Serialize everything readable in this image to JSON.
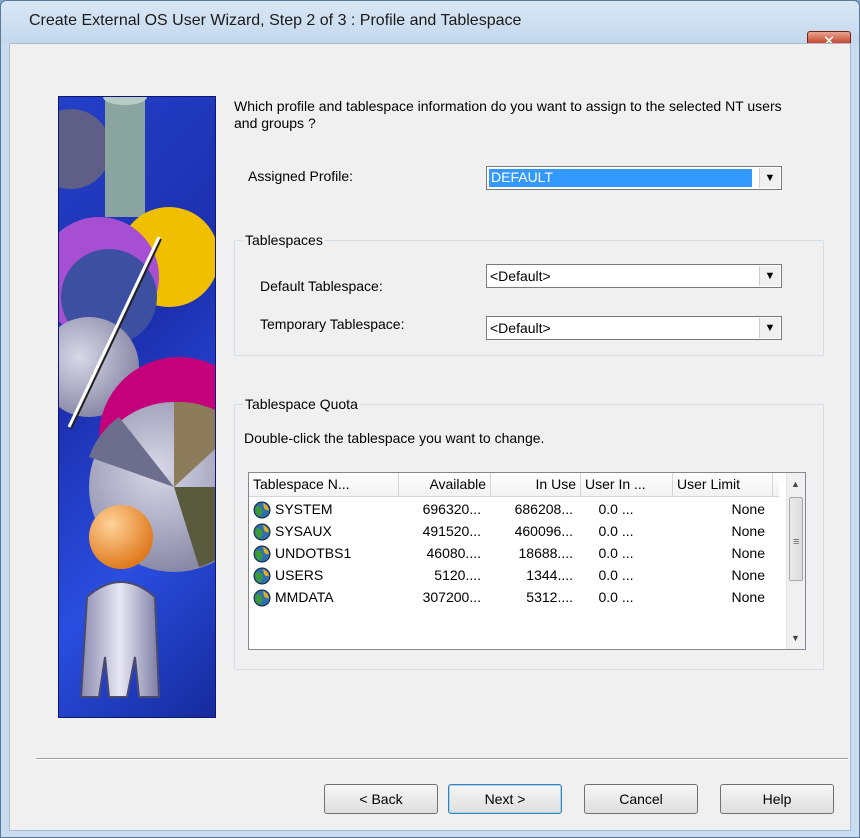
{
  "window": {
    "title": "Create External OS User Wizard, Step 2 of 3 : Profile and Tablespace",
    "close_glyph": "✕"
  },
  "question": "Which profile and tablespace information do you want to assign to the selected NT users and groups ?",
  "profile": {
    "label": "Assigned Profile:",
    "value": "DEFAULT"
  },
  "tablespaces": {
    "group_title": "Tablespaces",
    "default_label": "Default Tablespace:",
    "default_value": "<Default>",
    "temporary_label": "Temporary Tablespace:",
    "temporary_value": "<Default>"
  },
  "quota": {
    "group_title": "Tablespace Quota",
    "instruction": "Double-click the tablespace you want to change.",
    "columns": [
      "Tablespace N...",
      "Available",
      "In Use",
      "User In ...",
      "User Limit"
    ],
    "rows": [
      [
        "SYSTEM",
        "696320...",
        "686208...",
        "0.0 ...",
        "None"
      ],
      [
        "SYSAUX",
        "491520...",
        "460096...",
        "0.0 ...",
        "None"
      ],
      [
        "UNDOTBS1",
        "46080....",
        "18688....",
        "0.0 ...",
        "None"
      ],
      [
        "USERS",
        "5120....",
        "1344....",
        "0.0 ...",
        "None"
      ],
      [
        "MMDATA",
        "307200...",
        "5312....",
        "0.0 ...",
        "None"
      ]
    ]
  },
  "buttons": {
    "back": "< Back",
    "next": "Next >",
    "cancel": "Cancel",
    "help": "Help"
  },
  "colors": {
    "selection": "#3399ff",
    "dialog_bg": "#f0f0f0",
    "close_button": "#c8472a"
  },
  "icons": {
    "row_icon": "tablespace-globe-icon",
    "dropdown": "chevron-down-icon"
  }
}
